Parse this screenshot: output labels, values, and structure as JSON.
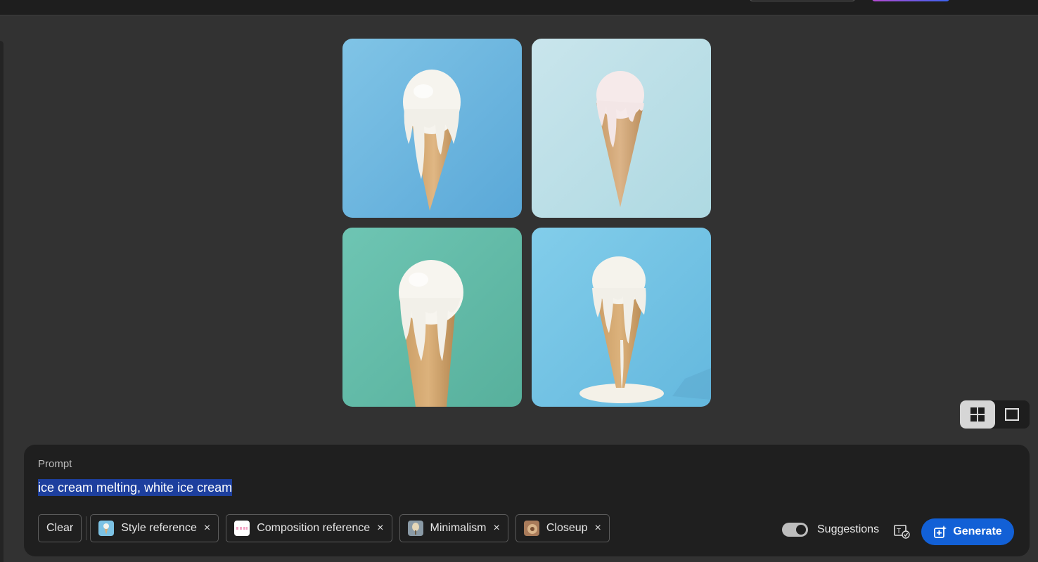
{
  "colors": {
    "background": "#323232",
    "panel": "#1f1f1f",
    "accent": "#1260d6",
    "selection": "#1d3f9e"
  },
  "images": [
    {
      "name": "ice cream on blue",
      "bg": "#78c0e2"
    },
    {
      "name": "ice cream on pale blue",
      "bg": "#bfe1e8"
    },
    {
      "name": "ice cream on teal",
      "bg": "#68c0ae"
    },
    {
      "name": "ice cream on sky blue with puddle",
      "bg": "#78c8e8"
    }
  ],
  "view_toggle": {
    "grid_icon": "grid-view-icon",
    "single_icon": "single-view-icon",
    "active": "grid"
  },
  "prompt": {
    "label": "Prompt",
    "text": "ice cream melting, white ice cream"
  },
  "chips": {
    "clear_label": "Clear",
    "items": [
      {
        "label": "Style reference",
        "icon": "style-reference-thumb"
      },
      {
        "label": "Composition reference",
        "icon": "composition-reference-thumb"
      },
      {
        "label": "Minimalism",
        "icon": "minimalism-thumb"
      },
      {
        "label": "Closeup",
        "icon": "closeup-thumb"
      }
    ],
    "remove_symbol": "×"
  },
  "suggestions": {
    "label": "Suggestions",
    "enabled": true
  },
  "generate": {
    "label": "Generate"
  }
}
